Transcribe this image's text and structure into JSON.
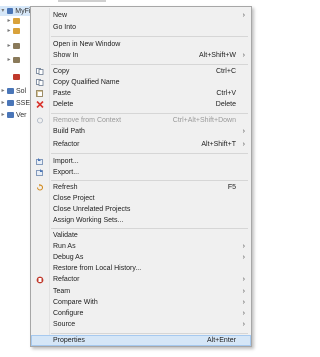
{
  "tree": {
    "project": "MyFirstProject",
    "nodes": [
      "Sol",
      "SSE",
      "Ver"
    ]
  },
  "menu": {
    "items": [
      {
        "label": "New",
        "sub": true
      },
      {
        "label": "Go Into"
      },
      {
        "label": "Open in New Window"
      },
      {
        "label": "Show In",
        "shortcut": "Alt+Shift+W",
        "sub": true
      },
      {
        "label": "Copy",
        "shortcut": "Ctrl+C",
        "icon": "copy-icon"
      },
      {
        "label": "Copy Qualified Name",
        "icon": "copy-icon"
      },
      {
        "label": "Paste",
        "shortcut": "Ctrl+V",
        "icon": "paste-icon"
      },
      {
        "label": "Delete",
        "shortcut": "Delete",
        "icon": "delete-icon"
      },
      {
        "label": "Remove from Context",
        "shortcut": "Ctrl+Alt+Shift+Down",
        "icon": "remove-context-icon",
        "disabled": true
      },
      {
        "label": "Build Path",
        "sub": true
      },
      {
        "label": "Refactor",
        "shortcut": "Alt+Shift+T",
        "sub": true
      },
      {
        "label": "Import...",
        "icon": "import-icon"
      },
      {
        "label": "Export...",
        "icon": "export-icon"
      },
      {
        "label": "Refresh",
        "shortcut": "F5",
        "icon": "refresh-icon"
      },
      {
        "label": "Close Project"
      },
      {
        "label": "Close Unrelated Projects"
      },
      {
        "label": "Assign Working Sets..."
      },
      {
        "label": "Validate"
      },
      {
        "label": "Run As",
        "sub": true
      },
      {
        "label": "Debug As",
        "sub": true
      },
      {
        "label": "Restore from Local History..."
      },
      {
        "label": "Refactor",
        "sub": true,
        "icon": "refactor-icon"
      },
      {
        "label": "Team",
        "sub": true
      },
      {
        "label": "Compare With",
        "sub": true
      },
      {
        "label": "Configure",
        "sub": true
      },
      {
        "label": "Source",
        "sub": true
      },
      {
        "label": "Properties",
        "shortcut": "Alt+Enter",
        "highlighted": true
      }
    ]
  },
  "colors": {
    "menu_bg": "#f0f0f0",
    "highlight": "#d5e6f7",
    "delete_red": "#d9322b",
    "refactor_red": "#c0392b"
  }
}
